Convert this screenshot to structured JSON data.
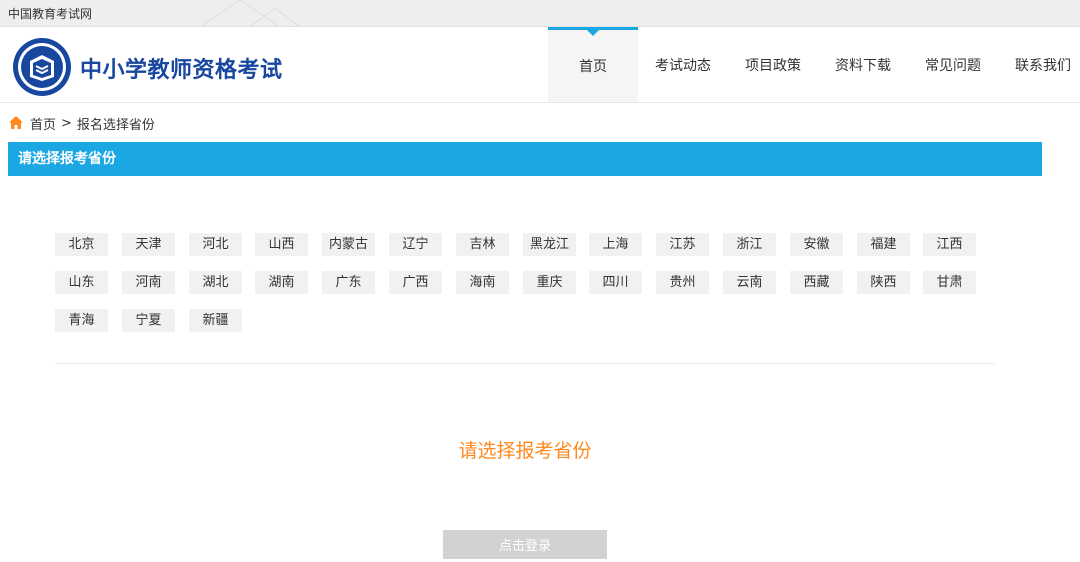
{
  "topbar": {
    "site_link": "中国教育考试网"
  },
  "header": {
    "title": "中小学教师资格考试"
  },
  "nav": {
    "items": [
      {
        "label": "首页",
        "active": true
      },
      {
        "label": "考试动态",
        "active": false
      },
      {
        "label": "项目政策",
        "active": false
      },
      {
        "label": "资料下载",
        "active": false
      },
      {
        "label": "常见问题",
        "active": false
      },
      {
        "label": "联系我们",
        "active": false
      }
    ]
  },
  "breadcrumb": {
    "home": "首页",
    "separator": ">",
    "current": "报名选择省份"
  },
  "section": {
    "title": "请选择报考省份"
  },
  "provinces": [
    "北京",
    "天津",
    "河北",
    "山西",
    "内蒙古",
    "辽宁",
    "吉林",
    "黑龙江",
    "上海",
    "江苏",
    "浙江",
    "安徽",
    "福建",
    "江西",
    "山东",
    "河南",
    "湖北",
    "湖南",
    "广东",
    "广西",
    "海南",
    "重庆",
    "四川",
    "贵州",
    "云南",
    "西藏",
    "陕西",
    "甘肃",
    "青海",
    "宁夏",
    "新疆"
  ],
  "hint": "请选择报考省份",
  "login_button": "点击登录",
  "colors": {
    "accent": "#1ba7e3",
    "brand": "#17479e",
    "hint": "#ff8a1f",
    "disabled_button": "#d2d2d2"
  },
  "icons": {
    "home": "home-icon",
    "logo": "teacher-cert-logo"
  }
}
